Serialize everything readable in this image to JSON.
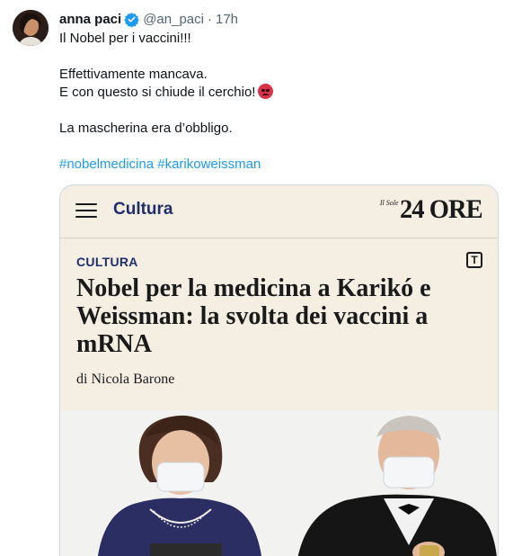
{
  "tweet": {
    "display_name": "anna paci",
    "handle": "@an_paci",
    "separator": "·",
    "time": "17h",
    "lines": [
      "Il Nobel per i vaccini!!!",
      "Effettivamente mancava.",
      "E con questo si chiude il cerchio!",
      "La mascherina era d’obbligo."
    ],
    "hashtags": [
      "#nobelmedicina",
      "#karikoweissman"
    ]
  },
  "icons": {
    "verified": "verified-badge-icon",
    "emoji": "enraged-face-emoji",
    "menu": "hamburger-menu-icon",
    "tbox": "text-size-icon"
  },
  "card": {
    "nav_section": "Cultura",
    "logo_small": "Il Sole",
    "logo_big": "24 ORE",
    "kicker": "CULTURA",
    "tbox_letter": "T",
    "headline": "Nobel per la medicina a Karikó e Weissman: la svolta dei vaccini a mRNA",
    "byline": "di Nicola Barone"
  },
  "colors": {
    "accent_blue": "#1d9bf0",
    "card_bg": "#f5eee2",
    "section_navy": "#1f2f6b",
    "verified_blue": "#1d9bf0"
  }
}
